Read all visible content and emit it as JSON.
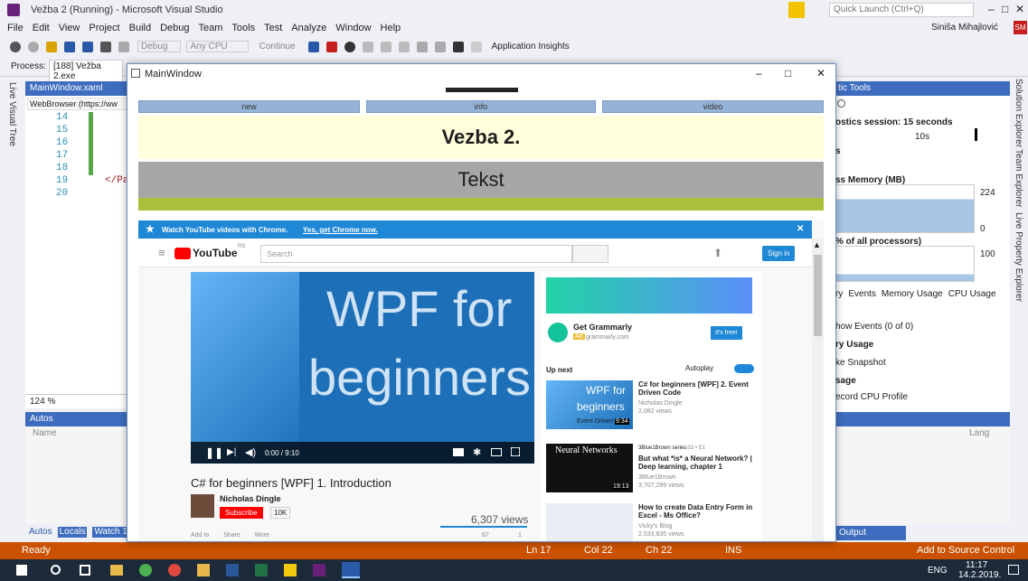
{
  "vs": {
    "title": "Vežba 2 (Running) - Microsoft Visual Studio",
    "quick_launch": "Quick Launch (Ctrl+Q)",
    "user": "Siniša Mihajlović",
    "user_initials": "SM",
    "menu": [
      "File",
      "Edit",
      "View",
      "Project",
      "Build",
      "Debug",
      "Team",
      "Tools",
      "Test",
      "Analyze",
      "Window",
      "Help"
    ],
    "toolbar": {
      "config": "Debug",
      "platform": "Any CPU",
      "continue": "Continue",
      "insights": "Application Insights"
    },
    "process_label": "Process:",
    "process_value": "[188] Vežba 2.exe",
    "left_strip": "Live Visual Tree",
    "right_strip": [
      "Solution Explorer",
      "Team Explorer",
      "Live Property Explorer"
    ],
    "editor_tab": "MainWindow.xaml",
    "editor_nav": "WebBrowser (https://ww",
    "line_numbers": [
      "14",
      "15",
      "16",
      "17",
      "18",
      "19",
      "20"
    ],
    "code_fragment": "</Pa",
    "zoom": "124 %",
    "autos_title": "Autos",
    "autos_col": "Name",
    "bottom_tabs": [
      "Autos",
      "Locals",
      "Watch 1"
    ],
    "diag": {
      "title": "tic Tools",
      "session": "ostics session: 15 seconds",
      "tick": "10s",
      "s": "s",
      "mem": "ss Memory (MB)",
      "mem_max": "224",
      "mem_min": "0",
      "cpu": "% of all processors)",
      "cpu_max": "100",
      "tabs": [
        "ry",
        "Events",
        "Memory Usage",
        "CPU Usage"
      ],
      "show_events": "how Events (0 of 0)",
      "ry_usage": "ry Usage",
      "snapshot": "ke Snapshot",
      "sage": "sage",
      "cpu_profile": "ecord CPU Profile"
    },
    "lang": "Lang",
    "output_tab": "Output",
    "status": {
      "ready": "Ready",
      "ln": "Ln 17",
      "col": "Col 22",
      "ch": "Ch 22",
      "ins": "INS",
      "source": "Add to Source Control"
    },
    "taskbar": {
      "lang": "ENG",
      "time": "11:17",
      "date": "14.2.2019."
    }
  },
  "main_window": {
    "title": "MainWindow",
    "nav": [
      "new",
      "info",
      "video"
    ],
    "heading": "Vezba 2.",
    "tekst": "Tekst"
  },
  "youtube": {
    "chrome_banner": "Watch YouTube videos with Chrome.",
    "chrome_link": "Yes, get Chrome now.",
    "logo": "YouTube",
    "logo_sup": "RS",
    "search": "Search",
    "signin": "Sign in",
    "player_text_1": "WPF for",
    "player_text_2": "beginners",
    "time": "0:00 / 9:10",
    "video_title": "C# for beginners [WPF] 1. Introduction",
    "channel": "Nicholas Dingle",
    "subscribe": "Subscribe",
    "subs": "10K",
    "views": "6,307 views",
    "actions": [
      "Add to",
      "Share",
      "More"
    ],
    "likes": "67",
    "dislikes": "1",
    "ad": {
      "name": "Get Grammarly",
      "tag": "Ad",
      "url": "grammarly.com",
      "cta": "It's free!"
    },
    "up_next": "Up next",
    "autoplay": "Autoplay",
    "related": [
      {
        "title": "C# for beginners [WPF] 2. Event Driven Code",
        "channel": "Nicholas Dingle",
        "views": "2,082 views",
        "thumb_1": "WPF for",
        "thumb_2": "beginners",
        "thumb_caption": "Event Driven",
        "duration": "9:34"
      },
      {
        "title": "But what *is* a Neural Network? | Deep learning, chapter 1",
        "channel": "3Blue1Brown",
        "views": "3,707,299 views",
        "thumb_1": "Neural Networks",
        "badge": "3Blue1Brown series",
        "ep": "S3 • E1",
        "duration": "19:13"
      },
      {
        "title": "How to create Data Entry Form in Excel - Ms Office?",
        "channel": "Vicky's Blog",
        "views": "2,533,835 views"
      }
    ]
  },
  "colors": {
    "vs_blue": "#3e6dbf",
    "status_orange": "#ca5100",
    "yt_red": "#ff0000",
    "yt_blue": "#1e88d7"
  }
}
